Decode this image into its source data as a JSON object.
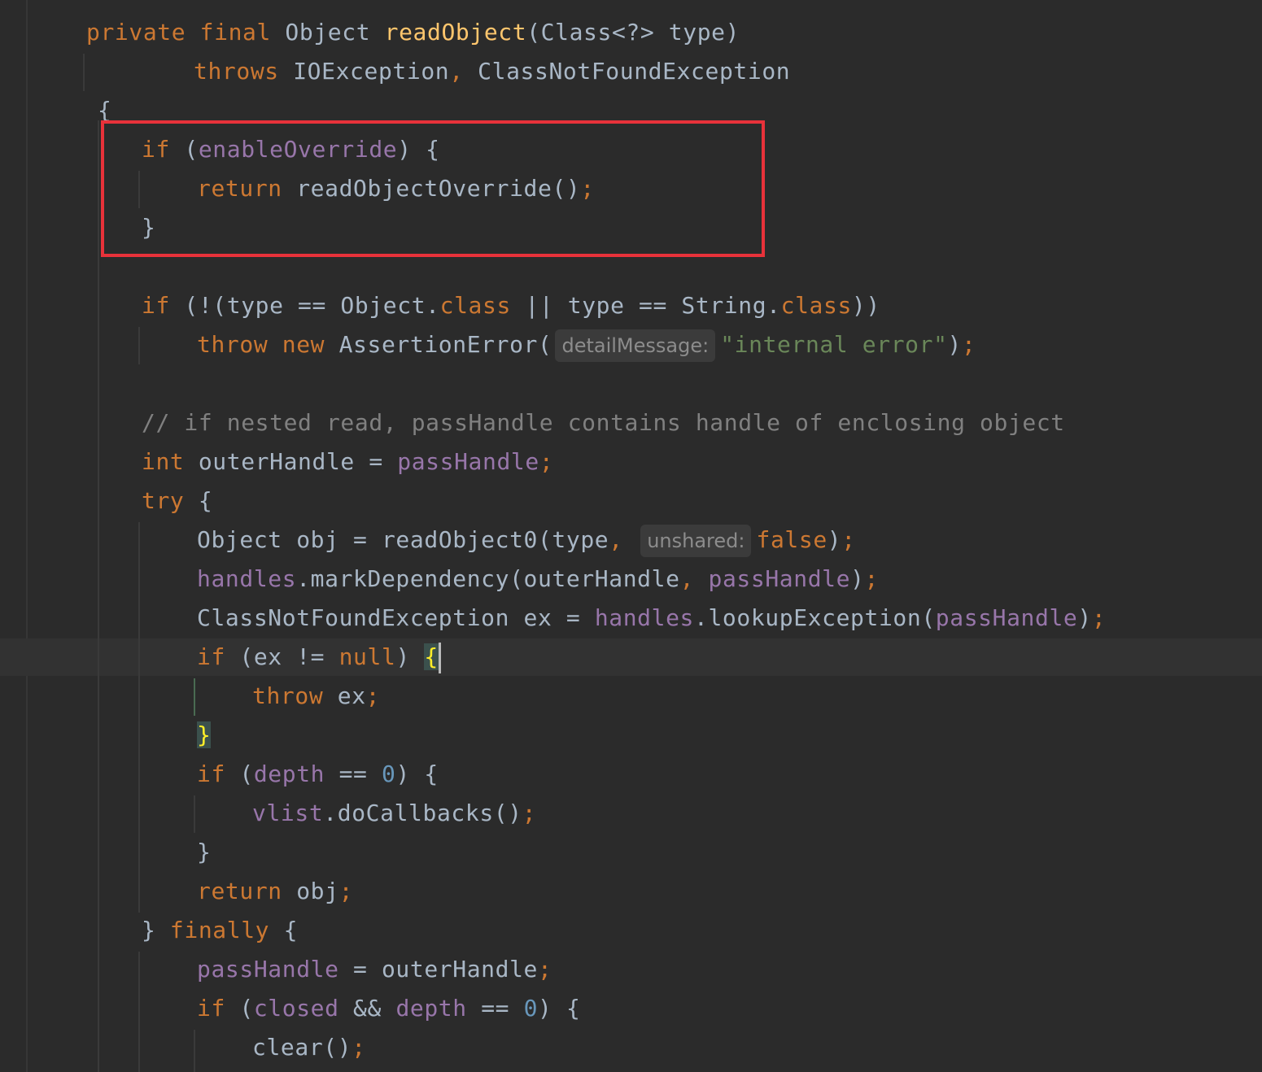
{
  "editor": {
    "theme_colors": {
      "background": "#2b2b2b",
      "keyword": "#cc7832",
      "method_declaration": "#ffc66d",
      "field": "#9876aa",
      "string": "#6a8759",
      "number": "#6897bb",
      "comment": "#808080",
      "plain": "#a9b7c6",
      "highlight_box": "#e8323a"
    },
    "lines": [
      {
        "tokens": [
          {
            "t": "private",
            "c": "kw"
          },
          {
            "t": " "
          },
          {
            "t": "final",
            "c": "kw"
          },
          {
            "t": " Object "
          },
          {
            "t": "readObject",
            "c": "fn"
          },
          {
            "t": "(Class<?> type)"
          }
        ]
      },
      {
        "tokens": [
          {
            "t": "throws",
            "c": "kw"
          },
          {
            "t": " IOException"
          },
          {
            "t": ",",
            "c": "kw"
          },
          {
            "t": " ClassNotFoundException"
          }
        ]
      },
      {
        "tokens": [
          {
            "t": "{"
          }
        ]
      },
      {
        "tokens": [
          {
            "t": "if",
            "c": "kw"
          },
          {
            "t": " ("
          },
          {
            "t": "enableOverride",
            "c": "fld"
          },
          {
            "t": ") {"
          }
        ]
      },
      {
        "tokens": [
          {
            "t": "return",
            "c": "kw"
          },
          {
            "t": " readObjectOverride()"
          },
          {
            "t": ";",
            "c": "kw"
          }
        ]
      },
      {
        "tokens": [
          {
            "t": "}"
          }
        ]
      },
      {
        "tokens": [
          {
            "t": "if",
            "c": "kw"
          },
          {
            "t": " (!(type == Object."
          },
          {
            "t": "class",
            "c": "kw"
          },
          {
            "t": " || type == String."
          },
          {
            "t": "class",
            "c": "kw"
          },
          {
            "t": "))"
          }
        ]
      },
      {
        "tokens": [
          {
            "t": "throw",
            "c": "kw"
          },
          {
            "t": " "
          },
          {
            "t": "new",
            "c": "kw"
          },
          {
            "t": " AssertionError("
          },
          {
            "t": "detailMessage:",
            "c": "hint"
          },
          {
            "t": "\"internal error\"",
            "c": "str"
          },
          {
            "t": ")"
          },
          {
            "t": ";",
            "c": "kw"
          }
        ]
      },
      {
        "tokens": [
          {
            "t": "// if nested read, passHandle contains handle of enclosing object",
            "c": "cmt"
          }
        ]
      },
      {
        "tokens": [
          {
            "t": "int",
            "c": "kw"
          },
          {
            "t": " outerHandle = "
          },
          {
            "t": "passHandle",
            "c": "fld"
          },
          {
            "t": ";",
            "c": "kw"
          }
        ]
      },
      {
        "tokens": [
          {
            "t": "try",
            "c": "kw"
          },
          {
            "t": " {"
          }
        ]
      },
      {
        "tokens": [
          {
            "t": "Object obj = readObject0(type"
          },
          {
            "t": ",",
            "c": "kw"
          },
          {
            "t": " "
          },
          {
            "t": "unshared:",
            "c": "hint"
          },
          {
            "t": "false",
            "c": "kw"
          },
          {
            "t": ")"
          },
          {
            "t": ";",
            "c": "kw"
          }
        ]
      },
      {
        "tokens": [
          {
            "t": "handles",
            "c": "fld"
          },
          {
            "t": ".markDependency(outerHandle"
          },
          {
            "t": ",",
            "c": "kw"
          },
          {
            "t": " "
          },
          {
            "t": "passHandle",
            "c": "fld"
          },
          {
            "t": ")"
          },
          {
            "t": ";",
            "c": "kw"
          }
        ]
      },
      {
        "tokens": [
          {
            "t": "ClassNotFoundException ex = "
          },
          {
            "t": "handles",
            "c": "fld"
          },
          {
            "t": ".lookupException("
          },
          {
            "t": "passHandle",
            "c": "fld"
          },
          {
            "t": ")"
          },
          {
            "t": ";",
            "c": "kw"
          }
        ]
      },
      {
        "tokens": [
          {
            "t": "if",
            "c": "kw"
          },
          {
            "t": " (ex != "
          },
          {
            "t": "null",
            "c": "kw"
          },
          {
            "t": ") "
          },
          {
            "t": "{",
            "c": "brace-hl"
          },
          {
            "t": "",
            "c": "cursor"
          }
        ]
      },
      {
        "tokens": [
          {
            "t": "throw",
            "c": "kw"
          },
          {
            "t": " ex"
          },
          {
            "t": ";",
            "c": "kw"
          }
        ]
      },
      {
        "tokens": [
          {
            "t": "}",
            "c": "brace-hl"
          }
        ]
      },
      {
        "tokens": [
          {
            "t": "if",
            "c": "kw"
          },
          {
            "t": " ("
          },
          {
            "t": "depth",
            "c": "fld"
          },
          {
            "t": " == "
          },
          {
            "t": "0",
            "c": "num"
          },
          {
            "t": ") {"
          }
        ]
      },
      {
        "tokens": [
          {
            "t": "vlist",
            "c": "fld"
          },
          {
            "t": ".doCallbacks()"
          },
          {
            "t": ";",
            "c": "kw"
          }
        ]
      },
      {
        "tokens": [
          {
            "t": "}"
          }
        ]
      },
      {
        "tokens": [
          {
            "t": "return",
            "c": "kw"
          },
          {
            "t": " obj"
          },
          {
            "t": ";",
            "c": "kw"
          }
        ]
      },
      {
        "tokens": [
          {
            "t": "} "
          },
          {
            "t": "finally",
            "c": "kw"
          },
          {
            "t": " {"
          }
        ]
      },
      {
        "tokens": [
          {
            "t": "passHandle",
            "c": "fld"
          },
          {
            "t": " = outerHandle"
          },
          {
            "t": ";",
            "c": "kw"
          }
        ]
      },
      {
        "tokens": [
          {
            "t": "if",
            "c": "kw"
          },
          {
            "t": " ("
          },
          {
            "t": "closed",
            "c": "fld"
          },
          {
            "t": " && "
          },
          {
            "t": "depth",
            "c": "fld"
          },
          {
            "t": " == "
          },
          {
            "t": "0",
            "c": "num"
          },
          {
            "t": ") {"
          }
        ]
      },
      {
        "tokens": [
          {
            "t": "clear()"
          },
          {
            "t": ";",
            "c": "kw"
          }
        ]
      }
    ]
  }
}
